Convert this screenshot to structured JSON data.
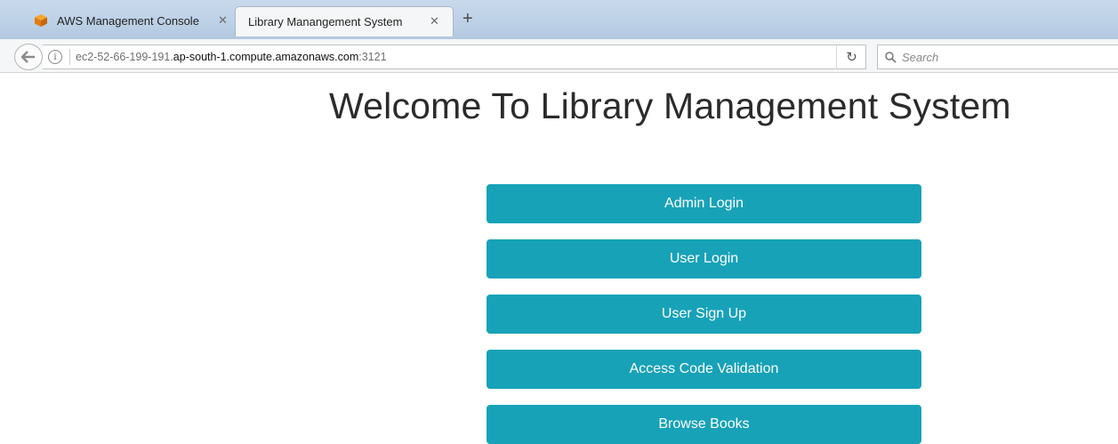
{
  "browser": {
    "tabs": [
      {
        "label": "AWS Management Console",
        "active": false
      },
      {
        "label": "Library Manangement System",
        "active": true
      }
    ],
    "address": {
      "prefix": "ec2-52-66-199-191.",
      "host": "ap-south-1.compute.amazonaws.com",
      "suffix": ":3121"
    },
    "search_placeholder": "Search"
  },
  "page": {
    "title": "Welcome To Library Management System",
    "buttons": [
      "Admin Login",
      "User Login",
      "User Sign Up",
      "Access Code Validation",
      "Browse Books"
    ]
  },
  "colors": {
    "button_bg": "#17a2b8",
    "button_text": "#ffffff",
    "title_text": "#2b2b2b"
  }
}
